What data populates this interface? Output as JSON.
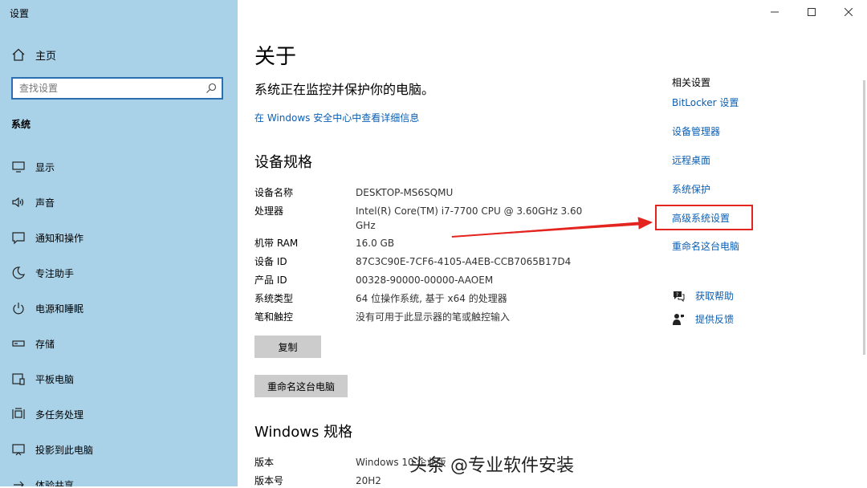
{
  "window": {
    "title": "设置"
  },
  "sidebar": {
    "home_label": "主页",
    "search_placeholder": "查找设置",
    "section_label": "系统",
    "items": [
      {
        "label": "显示",
        "icon": "monitor-icon"
      },
      {
        "label": "声音",
        "icon": "speaker-icon"
      },
      {
        "label": "通知和操作",
        "icon": "notification-icon"
      },
      {
        "label": "专注助手",
        "icon": "moon-icon"
      },
      {
        "label": "电源和睡眠",
        "icon": "power-icon"
      },
      {
        "label": "存储",
        "icon": "storage-icon"
      },
      {
        "label": "平板电脑",
        "icon": "tablet-icon"
      },
      {
        "label": "多任务处理",
        "icon": "multitask-icon"
      },
      {
        "label": "投影到此电脑",
        "icon": "project-icon"
      },
      {
        "label": "体验共享",
        "icon": "share-icon"
      }
    ]
  },
  "main": {
    "title": "关于",
    "status": "系统正在监控并保护你的电脑。",
    "security_link": "在 Windows 安全中心中查看详细信息",
    "device_specs_title": "设备规格",
    "device_specs": [
      {
        "key": "设备名称",
        "value": "DESKTOP-MS6SQMU"
      },
      {
        "key": "处理器",
        "value": "Intel(R) Core(TM) i7-7700 CPU @ 3.60GHz   3.60 GHz"
      },
      {
        "key": "机带 RAM",
        "value": "16.0 GB"
      },
      {
        "key": "设备 ID",
        "value": "87C3C90E-7CF6-4105-A4EB-CCB7065B17D4"
      },
      {
        "key": "产品 ID",
        "value": "00328-90000-00000-AAOEM"
      },
      {
        "key": "系统类型",
        "value": "64 位操作系统, 基于 x64 的处理器"
      },
      {
        "key": "笔和触控",
        "value": "没有可用于此显示器的笔或触控输入"
      }
    ],
    "copy_button": "复制",
    "rename_button": "重命名这台电脑",
    "windows_specs_title": "Windows 规格",
    "windows_specs": [
      {
        "key": "版本",
        "value": "Windows 10 企业版"
      },
      {
        "key": "版本号",
        "value": "20H2"
      }
    ]
  },
  "related": {
    "title": "相关设置",
    "links": [
      "BitLocker 设置",
      "设备管理器",
      "远程桌面",
      "系统保护",
      "高级系统设置",
      "重命名这台电脑"
    ],
    "help_label": "获取帮助",
    "feedback_label": "提供反馈"
  },
  "annotation": {
    "highlight_color": "#e4241f"
  },
  "watermark": "头条 @专业软件安装"
}
